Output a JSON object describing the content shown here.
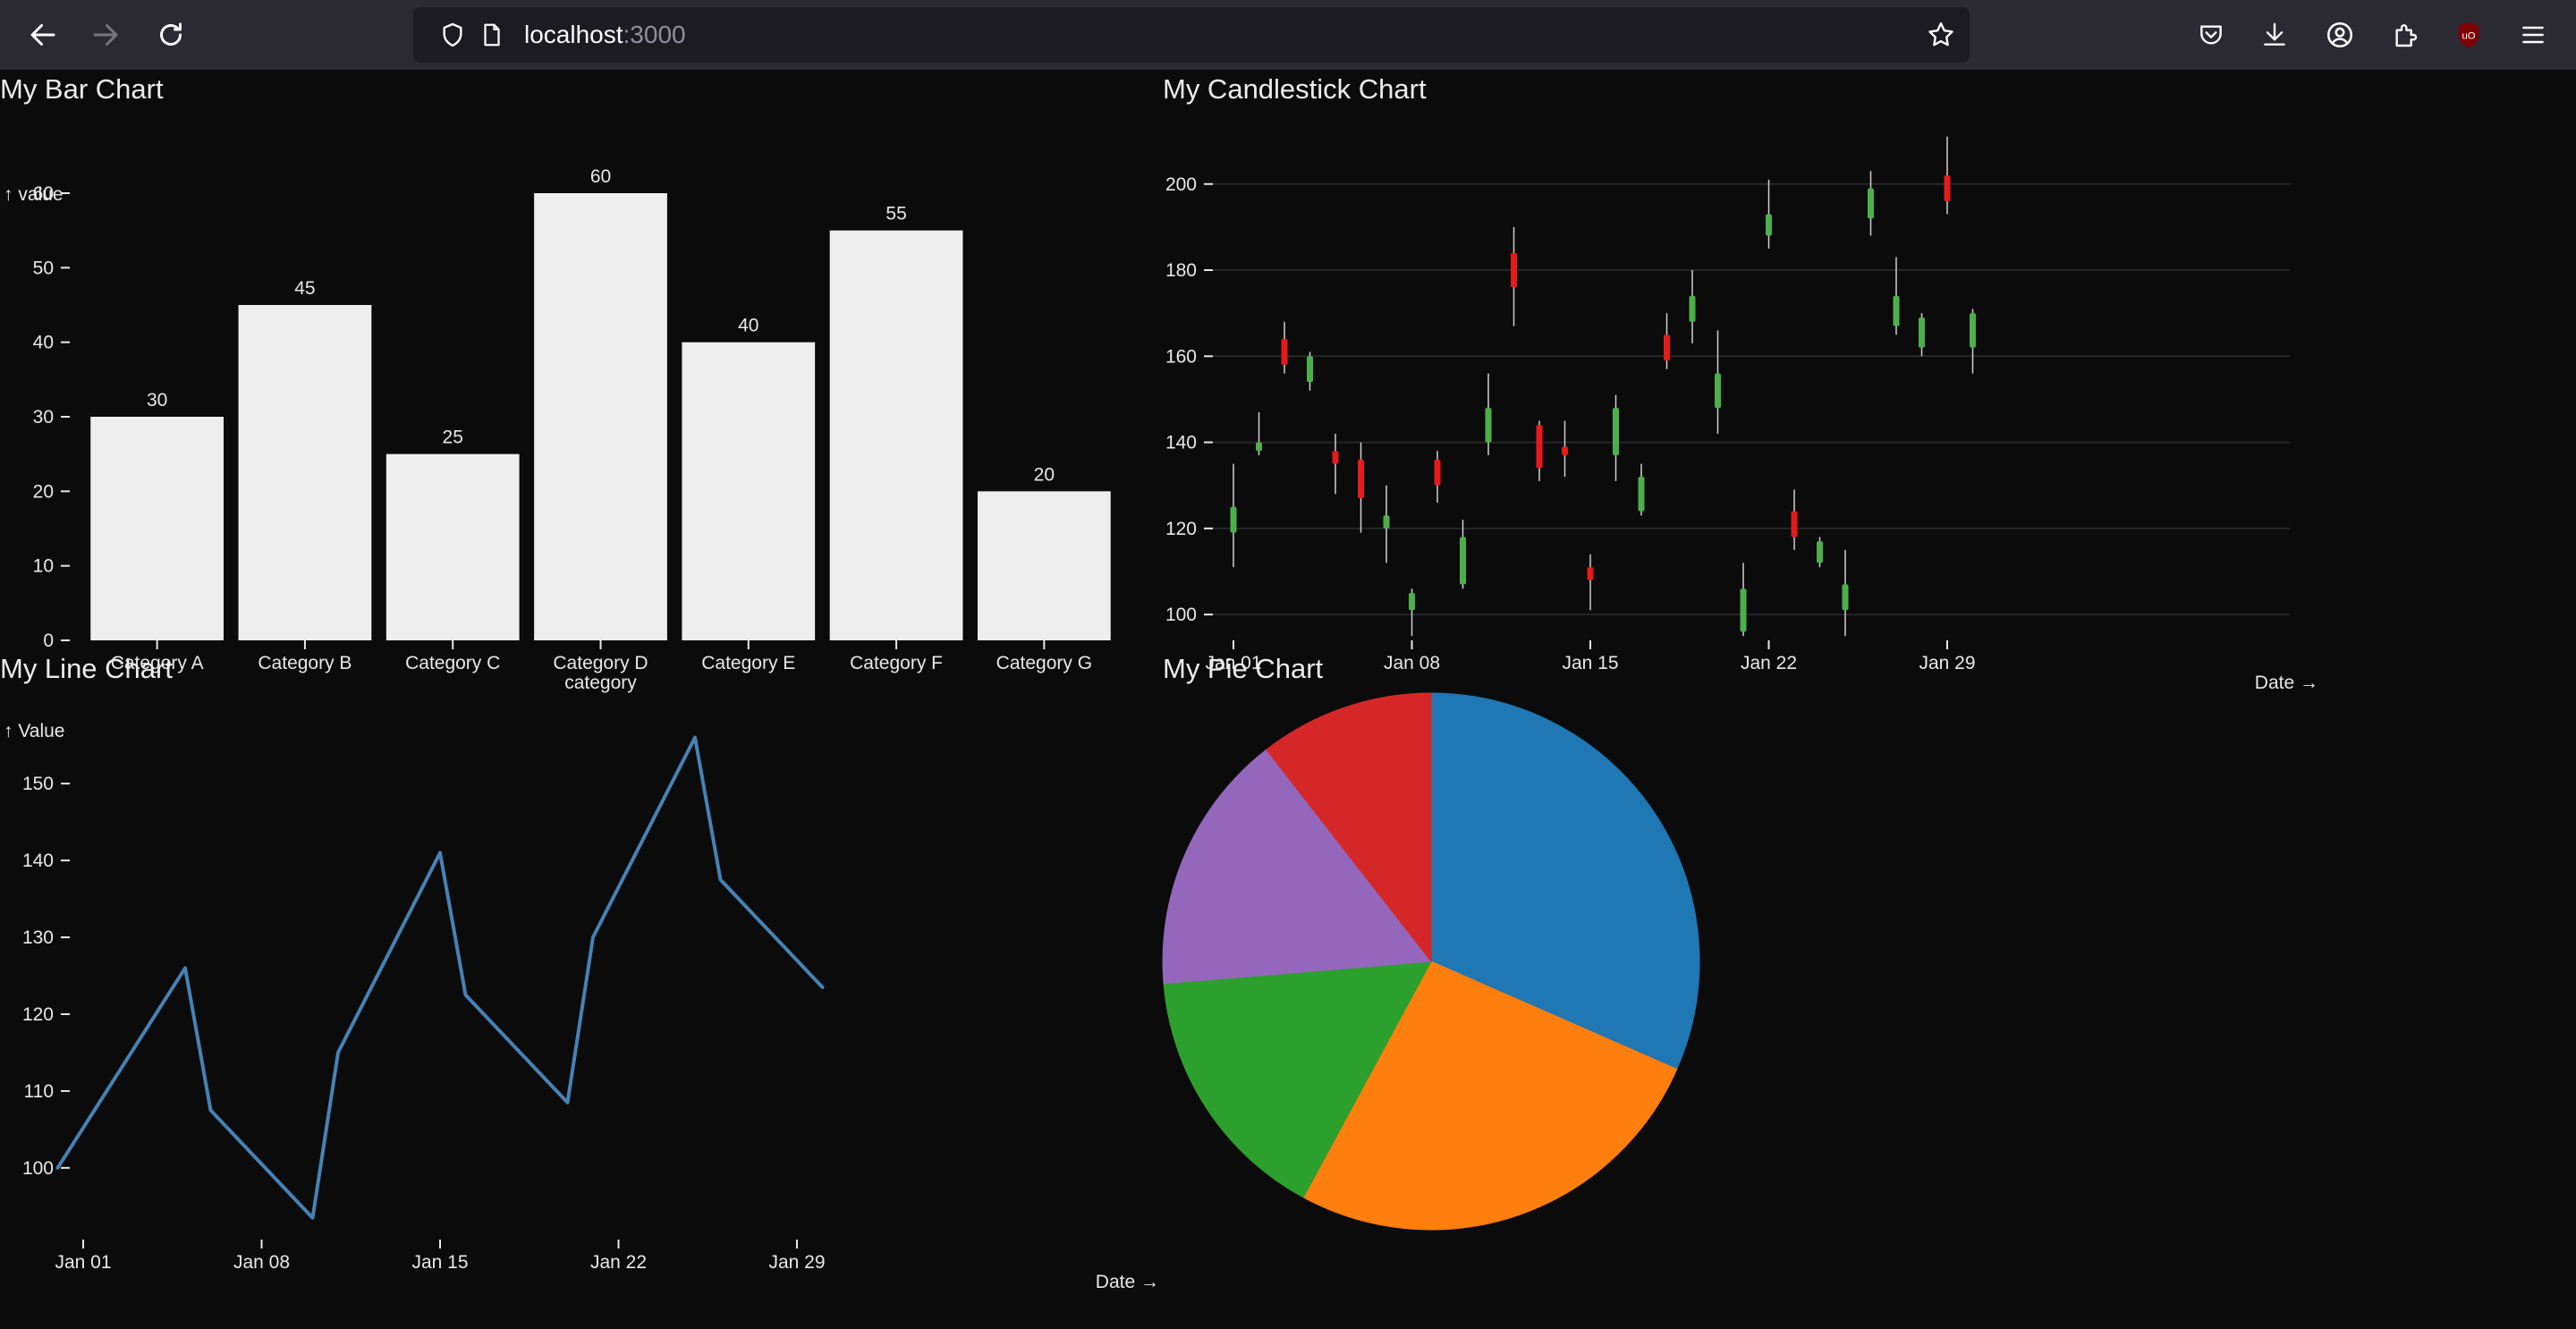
{
  "browser": {
    "url_host": "localhost",
    "url_port": ":3000",
    "icons": [
      "back-arrow-icon",
      "forward-arrow-icon",
      "reload-icon",
      "shield-icon",
      "page-icon",
      "star-icon",
      "pocket-icon",
      "download-icon",
      "account-icon",
      "extensions-icon",
      "ublock-icon",
      "menu-icon"
    ]
  },
  "colors": {
    "background": "#0b0b0c",
    "bar_fill": "#eeeeee",
    "line": "#4682b4",
    "candle_up": "#4daf4a",
    "candle_down": "#e41a1c",
    "pie": [
      "#1f77b4",
      "#ff7f0e",
      "#2ca02c",
      "#9467bd",
      "#d62728"
    ]
  },
  "chart_data": [
    {
      "type": "bar",
      "title": "My Bar Chart",
      "ylabel": "↑ value",
      "xlabel": "category",
      "categories": [
        "Category A",
        "Category B",
        "Category C",
        "Category D",
        "Category E",
        "Category F",
        "Category G"
      ],
      "values": [
        30,
        45,
        25,
        60,
        40,
        55,
        20
      ],
      "ylim": [
        0,
        60
      ],
      "yticks": [
        0,
        10,
        20,
        30,
        40,
        50,
        60
      ],
      "data_labels": true
    },
    {
      "type": "candlestick",
      "title": "My Candlestick Chart",
      "xlabel": "Date →",
      "ylim": [
        94,
        212
      ],
      "yticks": [
        100,
        120,
        140,
        160,
        180,
        200
      ],
      "xticks": [
        "Jan 01",
        "Jan 08",
        "Jan 15",
        "Jan 22",
        "Jan 29"
      ],
      "grid": true,
      "candles": [
        {
          "date": "2024-01-01",
          "open": 119,
          "high": 135,
          "low": 111,
          "close": 125
        },
        {
          "date": "2024-01-02",
          "open": 138,
          "high": 147,
          "low": 137,
          "close": 140
        },
        {
          "date": "2024-01-03",
          "open": 164,
          "high": 168,
          "low": 156,
          "close": 158
        },
        {
          "date": "2024-01-04",
          "open": 154,
          "high": 161,
          "low": 152,
          "close": 160
        },
        {
          "date": "2024-01-05",
          "open": 138,
          "high": 142,
          "low": 128,
          "close": 135
        },
        {
          "date": "2024-01-06",
          "open": 136,
          "high": 140,
          "low": 119,
          "close": 127
        },
        {
          "date": "2024-01-07",
          "open": 120,
          "high": 130,
          "low": 112,
          "close": 123
        },
        {
          "date": "2024-01-08",
          "open": 101,
          "high": 106,
          "low": 95,
          "close": 105
        },
        {
          "date": "2024-01-09",
          "open": 136,
          "high": 138,
          "low": 126,
          "close": 130
        },
        {
          "date": "2024-01-10",
          "open": 107,
          "high": 122,
          "low": 106,
          "close": 118
        },
        {
          "date": "2024-01-11",
          "open": 140,
          "high": 156,
          "low": 137,
          "close": 148
        },
        {
          "date": "2024-01-12",
          "open": 184,
          "high": 190,
          "low": 167,
          "close": 176
        },
        {
          "date": "2024-01-13",
          "open": 144,
          "high": 145,
          "low": 131,
          "close": 134
        },
        {
          "date": "2024-01-14",
          "open": 139,
          "high": 145,
          "low": 132,
          "close": 137
        },
        {
          "date": "2024-01-15",
          "open": 111,
          "high": 114,
          "low": 101,
          "close": 108
        },
        {
          "date": "2024-01-16",
          "open": 137,
          "high": 151,
          "low": 131,
          "close": 148
        },
        {
          "date": "2024-01-17",
          "open": 124,
          "high": 135,
          "low": 123,
          "close": 132
        },
        {
          "date": "2024-01-18",
          "open": 165,
          "high": 170,
          "low": 157,
          "close": 159
        },
        {
          "date": "2024-01-19",
          "open": 168,
          "high": 180,
          "low": 163,
          "close": 174
        },
        {
          "date": "2024-01-20",
          "open": 148,
          "high": 166,
          "low": 142,
          "close": 156
        },
        {
          "date": "2024-01-21",
          "open": 96,
          "high": 112,
          "low": 95,
          "close": 106
        },
        {
          "date": "2024-01-22",
          "open": 188,
          "high": 201,
          "low": 185,
          "close": 193
        },
        {
          "date": "2024-01-23",
          "open": 124,
          "high": 129,
          "low": 115,
          "close": 118
        },
        {
          "date": "2024-01-24",
          "open": 112,
          "high": 118,
          "low": 111,
          "close": 117
        },
        {
          "date": "2024-01-25",
          "open": 101,
          "high": 115,
          "low": 95,
          "close": 107
        },
        {
          "date": "2024-01-26",
          "open": 192,
          "high": 203,
          "low": 188,
          "close": 199
        },
        {
          "date": "2024-01-27",
          "open": 167,
          "high": 183,
          "low": 165,
          "close": 174
        },
        {
          "date": "2024-01-28",
          "open": 162,
          "high": 170,
          "low": 160,
          "close": 169
        },
        {
          "date": "2024-01-29",
          "open": 202,
          "high": 211,
          "low": 193,
          "close": 196
        },
        {
          "date": "2024-01-30",
          "open": 162,
          "high": 171,
          "low": 156,
          "close": 170
        }
      ]
    },
    {
      "type": "line",
      "title": "My Line Chart",
      "ylabel": "↑ Value",
      "xlabel": "Date →",
      "ylim": [
        93,
        157
      ],
      "yticks": [
        100,
        110,
        120,
        130,
        140,
        150
      ],
      "xticks": [
        "Jan 01",
        "Jan 08",
        "Jan 15",
        "Jan 22",
        "Jan 29"
      ],
      "x": [
        "2023-12-31",
        "2024-01-05",
        "2024-01-06",
        "2024-01-10",
        "2024-01-11",
        "2024-01-15",
        "2024-01-16",
        "2024-01-20",
        "2024-01-21",
        "2024-01-25",
        "2024-01-26",
        "2024-01-30"
      ],
      "values": [
        100,
        126,
        107.5,
        93.5,
        115,
        141,
        122.5,
        108.5,
        130,
        156,
        137.5,
        123.5
      ]
    },
    {
      "type": "pie",
      "title": "My Pie Chart",
      "slices": [
        {
          "value": 30,
          "color": "#1f77b4"
        },
        {
          "value": 25,
          "color": "#ff7f0e"
        },
        {
          "value": 15,
          "color": "#2ca02c"
        },
        {
          "value": 15,
          "color": "#9467bd"
        },
        {
          "value": 10,
          "color": "#d62728"
        }
      ]
    }
  ]
}
